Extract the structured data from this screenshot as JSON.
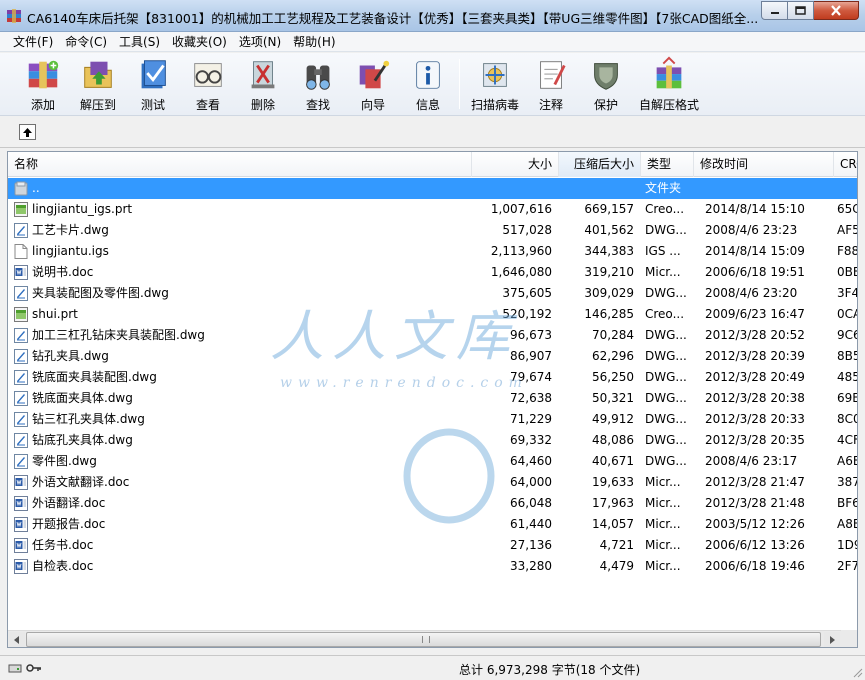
{
  "window": {
    "title": "CA6140车床后托架【831001】的机械加工工艺规程及工艺装备设计【优秀】【三套夹具类】【带UG三维零件图】【7张CAD图纸全..."
  },
  "menu": [
    "文件(F)",
    "命令(C)",
    "工具(S)",
    "收藏夹(O)",
    "选项(N)",
    "帮助(H)"
  ],
  "toolbar": [
    {
      "label": "添加",
      "icon": "add-archive-icon"
    },
    {
      "label": "解压到",
      "icon": "extract-to-icon"
    },
    {
      "label": "测试",
      "icon": "test-icon"
    },
    {
      "label": "查看",
      "icon": "view-icon"
    },
    {
      "label": "删除",
      "icon": "delete-icon"
    },
    {
      "label": "查找",
      "icon": "find-icon"
    },
    {
      "label": "向导",
      "icon": "wizard-icon"
    },
    {
      "label": "信息",
      "icon": "info-icon"
    },
    {
      "label": "扫描病毒",
      "icon": "virus-scan-icon"
    },
    {
      "label": "注释",
      "icon": "comment-icon"
    },
    {
      "label": "保护",
      "icon": "protect-icon"
    },
    {
      "label": "自解压格式",
      "icon": "sfx-icon"
    }
  ],
  "columns": {
    "name": "名称",
    "size": "大小",
    "packed": "压缩后大小",
    "type": "类型",
    "modified": "修改时间",
    "crc": "CRC"
  },
  "files": [
    {
      "name": "..",
      "size": "",
      "packed": "",
      "type": "文件夹",
      "modified": "",
      "crc": "",
      "kind": "folder"
    },
    {
      "name": "lingjiantu_igs.prt",
      "size": "1,007,616",
      "packed": "669,157",
      "type": "Creo...",
      "modified": "2014/8/14 15:10",
      "crc": "65C",
      "kind": "prt"
    },
    {
      "name": "工艺卡片.dwg",
      "size": "517,028",
      "packed": "401,562",
      "type": "DWG...",
      "modified": "2008/4/6 23:23",
      "crc": "AF5",
      "kind": "dwg"
    },
    {
      "name": "lingjiantu.igs",
      "size": "2,113,960",
      "packed": "344,383",
      "type": "IGS ...",
      "modified": "2014/8/14 15:09",
      "crc": "F88",
      "kind": "blank"
    },
    {
      "name": "说明书.doc",
      "size": "1,646,080",
      "packed": "319,210",
      "type": "Micr...",
      "modified": "2006/6/18 19:51",
      "crc": "0BE",
      "kind": "doc"
    },
    {
      "name": "夹具装配图及零件图.dwg",
      "size": "375,605",
      "packed": "309,029",
      "type": "DWG...",
      "modified": "2008/4/6 23:20",
      "crc": "3F4",
      "kind": "dwg"
    },
    {
      "name": "shui.prt",
      "size": "520,192",
      "packed": "146,285",
      "type": "Creo...",
      "modified": "2009/6/23 16:47",
      "crc": "0CA",
      "kind": "prt"
    },
    {
      "name": "加工三杠孔钻床夹具装配图.dwg",
      "size": "96,673",
      "packed": "70,284",
      "type": "DWG...",
      "modified": "2012/3/28 20:52",
      "crc": "9C6",
      "kind": "dwg"
    },
    {
      "name": "钻孔夹具.dwg",
      "size": "86,907",
      "packed": "62,296",
      "type": "DWG...",
      "modified": "2012/3/28 20:39",
      "crc": "8B5",
      "kind": "dwg"
    },
    {
      "name": "铣底面夹具装配图.dwg",
      "size": "79,674",
      "packed": "56,250",
      "type": "DWG...",
      "modified": "2012/3/28 20:49",
      "crc": "485",
      "kind": "dwg"
    },
    {
      "name": "铣底面夹具体.dwg",
      "size": "72,638",
      "packed": "50,321",
      "type": "DWG...",
      "modified": "2012/3/28 20:38",
      "crc": "69E",
      "kind": "dwg"
    },
    {
      "name": "钻三杠孔夹具体.dwg",
      "size": "71,229",
      "packed": "49,912",
      "type": "DWG...",
      "modified": "2012/3/28 20:33",
      "crc": "8C0",
      "kind": "dwg"
    },
    {
      "name": "钻底孔夹具体.dwg",
      "size": "69,332",
      "packed": "48,086",
      "type": "DWG...",
      "modified": "2012/3/28 20:35",
      "crc": "4CF",
      "kind": "dwg"
    },
    {
      "name": "零件图.dwg",
      "size": "64,460",
      "packed": "40,671",
      "type": "DWG...",
      "modified": "2008/4/6 23:17",
      "crc": "A6E",
      "kind": "dwg"
    },
    {
      "name": "外语文献翻译.doc",
      "size": "64,000",
      "packed": "19,633",
      "type": "Micr...",
      "modified": "2012/3/28 21:47",
      "crc": "387",
      "kind": "doc"
    },
    {
      "name": "外语翻译.doc",
      "size": "66,048",
      "packed": "17,963",
      "type": "Micr...",
      "modified": "2012/3/28 21:48",
      "crc": "BF6",
      "kind": "doc"
    },
    {
      "name": "开题报告.doc",
      "size": "61,440",
      "packed": "14,057",
      "type": "Micr...",
      "modified": "2003/5/12 12:26",
      "crc": "A8E",
      "kind": "doc"
    },
    {
      "name": "任务书.doc",
      "size": "27,136",
      "packed": "4,721",
      "type": "Micr...",
      "modified": "2006/6/12 13:26",
      "crc": "1D9",
      "kind": "doc"
    },
    {
      "name": "自检表.doc",
      "size": "33,280",
      "packed": "4,479",
      "type": "Micr...",
      "modified": "2006/6/18 19:46",
      "crc": "2F7",
      "kind": "doc"
    }
  ],
  "watermark": {
    "main": "人人文库",
    "url": "www.renrendoc.com"
  },
  "status": {
    "summary": "总计 6,973,298 字节(18 个文件)"
  },
  "colors": {
    "selection": "#3399ff",
    "titlebar": "#b7cfea"
  }
}
